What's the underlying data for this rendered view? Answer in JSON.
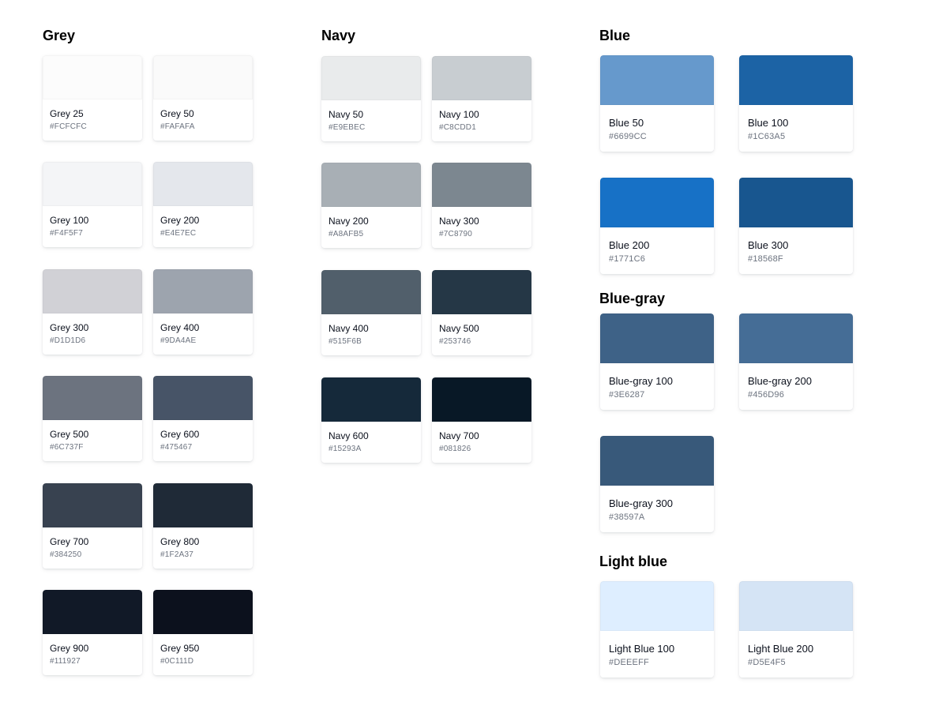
{
  "groups": {
    "grey": {
      "title": "Grey",
      "swatches": [
        {
          "name": "Grey 25",
          "hex": "#FCFCFC",
          "color": "#FCFCFC"
        },
        {
          "name": "Grey 50",
          "hex": "#FAFAFA",
          "color": "#FAFAFA"
        },
        {
          "name": "Grey 100",
          "hex": "#F4F5F7",
          "color": "#F4F5F7"
        },
        {
          "name": "Grey 200",
          "hex": "#E4E7EC",
          "color": "#E4E7EC"
        },
        {
          "name": "Grey 300",
          "hex": "#D1D1D6",
          "color": "#D1D1D6"
        },
        {
          "name": "Grey 400",
          "hex": "#9DA4AE",
          "color": "#9DA4AE"
        },
        {
          "name": "Grey 500",
          "hex": "#6C737F",
          "color": "#6C737F"
        },
        {
          "name": "Grey 600",
          "hex": "#475467",
          "color": "#475467"
        },
        {
          "name": "Grey 700",
          "hex": "#384250",
          "color": "#384250"
        },
        {
          "name": "Grey 800",
          "hex": "#1F2A37",
          "color": "#1F2A37"
        },
        {
          "name": "Grey 900",
          "hex": "#111927",
          "color": "#111927"
        },
        {
          "name": "Grey 950",
          "hex": "#0C111D",
          "color": "#0C111D"
        }
      ]
    },
    "navy": {
      "title": "Navy",
      "swatches": [
        {
          "name": "Navy 50",
          "hex": "#E9EBEC",
          "color": "#E9EBEC"
        },
        {
          "name": "Navy 100",
          "hex": "#C8CDD1",
          "color": "#C8CDD1"
        },
        {
          "name": "Navy 200",
          "hex": "#A8AFB5",
          "color": "#A8AFB5"
        },
        {
          "name": "Navy 300",
          "hex": "#7C8790",
          "color": "#7C8790"
        },
        {
          "name": "Navy 400",
          "hex": "#515F6B",
          "color": "#515F6B"
        },
        {
          "name": "Navy 500",
          "hex": "#253746",
          "color": "#253746"
        },
        {
          "name": "Navy 600",
          "hex": "#15293A",
          "color": "#15293A"
        },
        {
          "name": "Navy 700",
          "hex": "#081826",
          "color": "#081826"
        }
      ]
    },
    "blue": {
      "title": "Blue",
      "swatches": [
        {
          "name": "Blue 50",
          "hex": "#6699CC",
          "color": "#6699CC"
        },
        {
          "name": "Blue 100",
          "hex": "#1C63A5",
          "color": "#1C63A5"
        },
        {
          "name": "Blue 200",
          "hex": "#1771C6",
          "color": "#1771C6"
        },
        {
          "name": "Blue 300",
          "hex": "#18568F",
          "color": "#18568F"
        }
      ]
    },
    "bluegray": {
      "title": "Blue-gray",
      "swatches": [
        {
          "name": "Blue-gray 100",
          "hex": "#3E6287",
          "color": "#3E6287"
        },
        {
          "name": "Blue-gray 200",
          "hex": "#456D96",
          "color": "#456D96"
        },
        {
          "name": "Blue-gray 300",
          "hex": "#38597A",
          "color": "#38597A"
        }
      ]
    },
    "lightblue": {
      "title": "Light blue",
      "swatches": [
        {
          "name": "Light Blue 100",
          "hex": "#DEEEFF",
          "color": "#DEEEFF"
        },
        {
          "name": "Light Blue 200",
          "hex": "#D5E4F5",
          "color": "#D5E4F5"
        }
      ]
    }
  }
}
